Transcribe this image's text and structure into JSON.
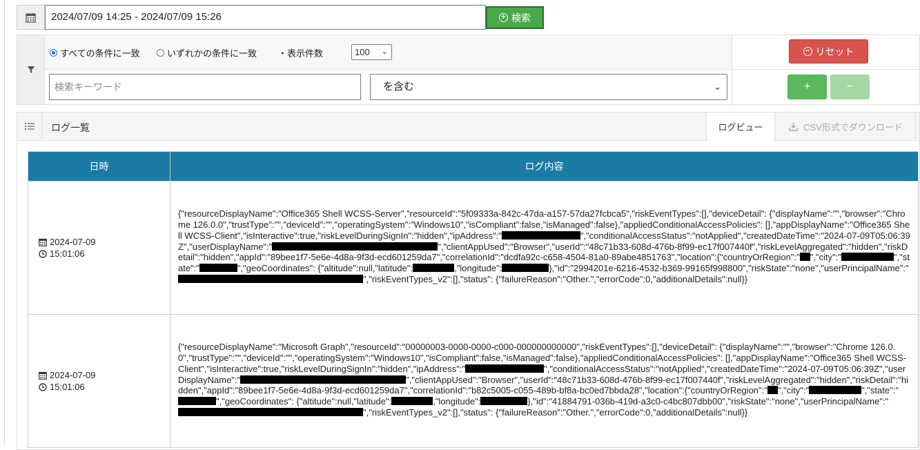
{
  "daterange": {
    "value": "2024/07/09 14:25 - 2024/07/09 15:26"
  },
  "search": {
    "label": "検索"
  },
  "filter": {
    "match_all_label": "すべての条件に一致",
    "match_any_label": "いずれかの条件に一致",
    "count_label": "・表示件数",
    "count_value": "100",
    "keyword_placeholder": "検索キーワード",
    "condition_value": "を含む",
    "reset_label": "リセット",
    "add_label": "+",
    "remove_label": "−"
  },
  "log": {
    "title": "ログ一覧",
    "tab_logview": "ログビュー",
    "tab_csv": "CSV形式でダウンロード",
    "col_datetime": "日時",
    "col_content": "ログ内容",
    "rows": [
      {
        "date": "2024-07-09",
        "time": "15:01:06",
        "p1": "{\"resourceDisplayName\":\"Office365 Shell WCSS-Server\",\"resourceId\":\"5f09333a-842c-47da-a157-57da27fcbca5\",\"riskEventTypes\":[],\"deviceDetail\": {\"displayName\":\"\",\"browser\":\"Chrome 126.0.0\",\"trustType\":\"\",\"deviceId\":\"\",\"operatingSystem\":\"Windows10\",\"isCompliant\":false,\"isManaged\":false},\"appliedConditionalAccessPolicies\": [],\"appDisplayName\":\"Office365 Shell WCSS-Client\",\"isInteractive\":true,\"riskLevelDuringSignIn\":\"hidden\",\"ipAddress\":\"",
        "p2": "\",\"conditionalAccessStatus\":\"notApplied\",\"createdDateTime\":\"2024-07-09T05:06:39Z\",\"userDisplayName\":\"",
        "p3": "\",\"clientAppUsed\":\"Browser\",\"userId\":\"48c71b33-608d-476b-8f99-ec17f007440f\",\"riskLevelAggregated\":\"hidden\",\"riskDetail\":\"hidden\",\"appId\":\"89bee1f7-5e6e-4d8a-9f3d-ecd601259da7\",\"correlationId\":\"dcdfa92c-c658-4504-81a0-89abe4851763\",\"location\":{\"countryOrRegion\":\"",
        "p4": "\",\"city\":\"",
        "p5": "\",\"state\":\"",
        "p6": "\",\"geoCoordinates\": {\"altitude\":null,\"latitude\":",
        "p7": ",\"longitude\":",
        "p8": "},\"id\":\"2994201e-6216-4532-b369-99165f998800\",\"riskState\":\"none\",\"userPrincipalName\":\"",
        "p9": "\",\"riskEventTypes_v2\":[],\"status\": {\"failureReason\":\"Other.\",\"errorCode\":0,\"additionalDetails\":null}}"
      },
      {
        "date": "2024-07-09",
        "time": "15:01:06",
        "p1": "{\"resourceDisplayName\":\"Microsoft Graph\",\"resourceId\":\"00000003-0000-0000-c000-000000000000\",\"riskEventTypes\":[],\"deviceDetail\": {\"displayName\":\"\",\"browser\":\"Chrome 126.0.0\",\"trustType\":\"\",\"deviceId\":\"\",\"operatingSystem\":\"Windows10\",\"isCompliant\":false,\"isManaged\":false},\"appliedConditionalAccessPolicies\": [],\"appDisplayName\":\"Office365 Shell WCSS-Client\",\"isInteractive\":true,\"riskLevelDuringSignIn\":\"hidden\",\"ipAddress\":\"",
        "p2": "\",\"conditionalAccessStatus\":\"notApplied\",\"createdDateTime\":\"2024-07-09T05:06:39Z\",\"userDisplayName\":\"",
        "p3": "\",\"clientAppUsed\":\"Browser\",\"userId\":\"48c71b33-608d-476b-8f99-ec17f007440f\",\"riskLevelAggregated\":\"hidden\",\"riskDetail\":\"hidden\",\"appId\":\"89bee1f7-5e6e-4d8a-9f3d-ecd601259da7\",\"correlationId\":\"b82c5005-c055-489b-bf8a-bc0ed7bbda28\",\"location\":{\"countryOrRegion\":\"",
        "p4": "\",\"city\":\"",
        "p5": "\",\"state\":\"",
        "p6": "\",\"geoCoordinates\": {\"altitude\":null,\"latitude\":",
        "p7": ",\"longitude\":",
        "p8": "},\"id\":\"41884791-036b-419d-a3c0-c4bc807dbb00\",\"riskState\":\"none\",\"userPrincipalName\":\"",
        "p9": "\",\"riskEventTypes_v2\":[],\"status\": {\"failureReason\":\"Other.\",\"errorCode\":0,\"additionalDetails\":null}}"
      }
    ]
  },
  "colors": {
    "search_green": "#4aa94a",
    "reset_red": "#d9534f",
    "add_green": "#5cb85c",
    "header_blue": "#1a7ca5"
  },
  "icons": [
    "calendar-icon",
    "plus-circle-icon",
    "filter-icon",
    "minus-circle-icon",
    "list-icon",
    "download-icon",
    "clock-icon"
  ]
}
